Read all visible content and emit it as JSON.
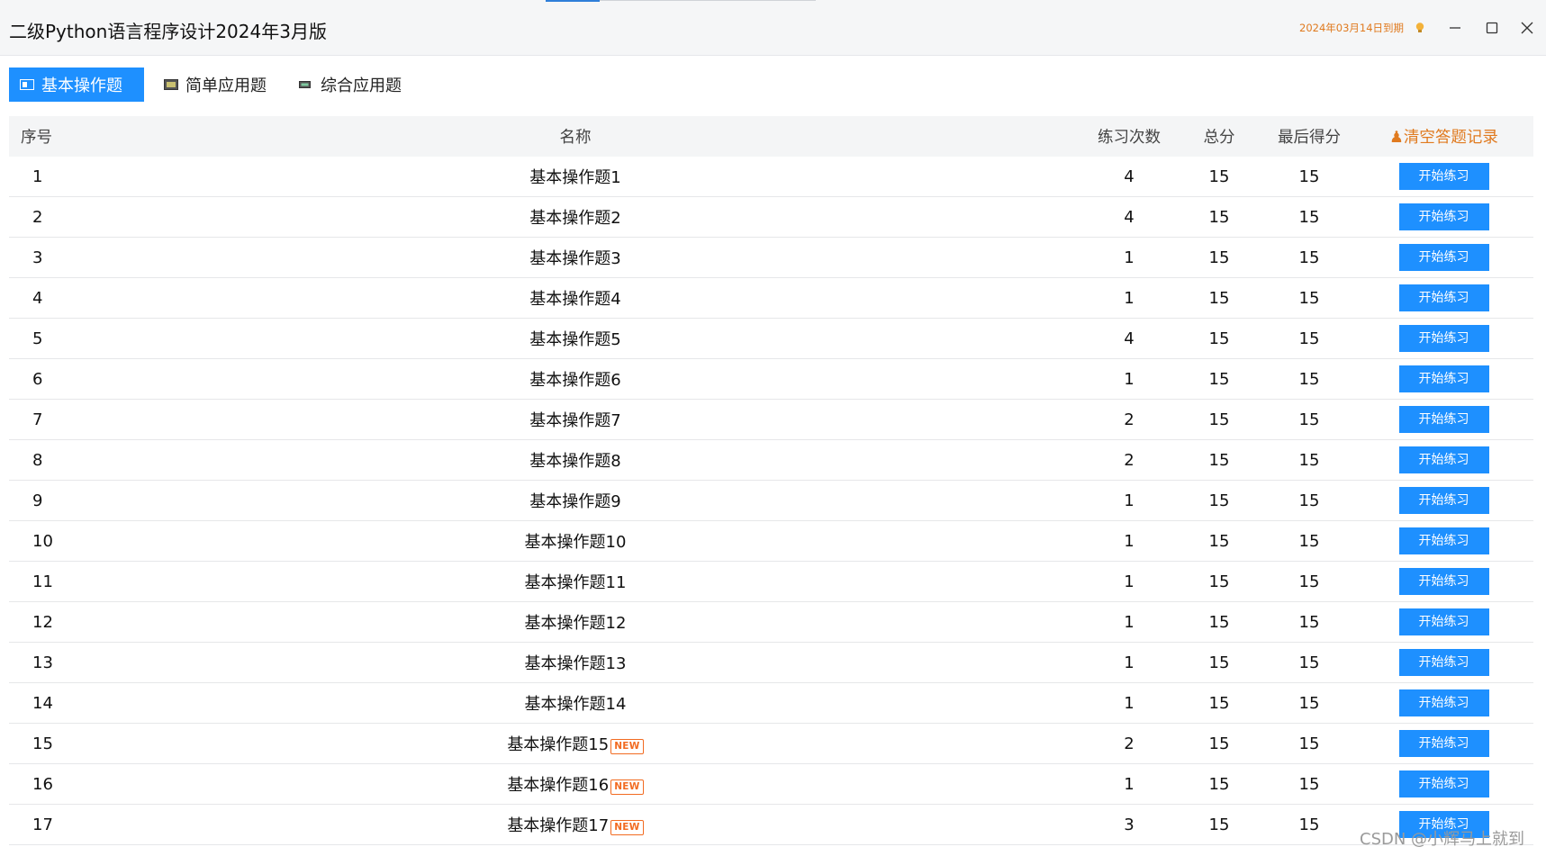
{
  "window": {
    "title": "二级Python语言程序设计2024年3月版",
    "expiry": "2024年03月14日到期",
    "controls": [
      "minimize-icon",
      "maximize-icon",
      "close-icon"
    ]
  },
  "tabs": [
    {
      "label": "基本操作题",
      "icon": "tab-icon",
      "active": true
    },
    {
      "label": "简单应用题",
      "icon": "tab-icon",
      "active": false
    },
    {
      "label": "综合应用题",
      "icon": "tab-icon",
      "active": false
    }
  ],
  "table": {
    "headers": {
      "index": "序号",
      "name": "名称",
      "count": "练习次数",
      "total": "总分",
      "last": "最后得分",
      "clear": "♟清空答题记录"
    },
    "action_label": "开始练习",
    "new_badge": "NEW",
    "rows": [
      {
        "index": "1",
        "name": "基本操作题1",
        "count": "4",
        "total": "15",
        "last": "15",
        "is_new": false
      },
      {
        "index": "2",
        "name": "基本操作题2",
        "count": "4",
        "total": "15",
        "last": "15",
        "is_new": false
      },
      {
        "index": "3",
        "name": "基本操作题3",
        "count": "1",
        "total": "15",
        "last": "15",
        "is_new": false
      },
      {
        "index": "4",
        "name": "基本操作题4",
        "count": "1",
        "total": "15",
        "last": "15",
        "is_new": false
      },
      {
        "index": "5",
        "name": "基本操作题5",
        "count": "4",
        "total": "15",
        "last": "15",
        "is_new": false
      },
      {
        "index": "6",
        "name": "基本操作题6",
        "count": "1",
        "total": "15",
        "last": "15",
        "is_new": false
      },
      {
        "index": "7",
        "name": "基本操作题7",
        "count": "2",
        "total": "15",
        "last": "15",
        "is_new": false
      },
      {
        "index": "8",
        "name": "基本操作题8",
        "count": "2",
        "total": "15",
        "last": "15",
        "is_new": false
      },
      {
        "index": "9",
        "name": "基本操作题9",
        "count": "1",
        "total": "15",
        "last": "15",
        "is_new": false
      },
      {
        "index": "10",
        "name": "基本操作题10",
        "count": "1",
        "total": "15",
        "last": "15",
        "is_new": false
      },
      {
        "index": "11",
        "name": "基本操作题11",
        "count": "1",
        "total": "15",
        "last": "15",
        "is_new": false
      },
      {
        "index": "12",
        "name": "基本操作题12",
        "count": "1",
        "total": "15",
        "last": "15",
        "is_new": false
      },
      {
        "index": "13",
        "name": "基本操作题13",
        "count": "1",
        "total": "15",
        "last": "15",
        "is_new": false
      },
      {
        "index": "14",
        "name": "基本操作题14",
        "count": "1",
        "total": "15",
        "last": "15",
        "is_new": false
      },
      {
        "index": "15",
        "name": "基本操作题15",
        "count": "2",
        "total": "15",
        "last": "15",
        "is_new": true
      },
      {
        "index": "16",
        "name": "基本操作题16",
        "count": "1",
        "total": "15",
        "last": "15",
        "is_new": true
      },
      {
        "index": "17",
        "name": "基本操作题17",
        "count": "3",
        "total": "15",
        "last": "15",
        "is_new": true
      }
    ]
  },
  "watermark": "CSDN @小辉马上就到",
  "colors": {
    "accent": "#1e90ff",
    "orange": "#e07a1f",
    "new_badge": "#f26b21"
  }
}
